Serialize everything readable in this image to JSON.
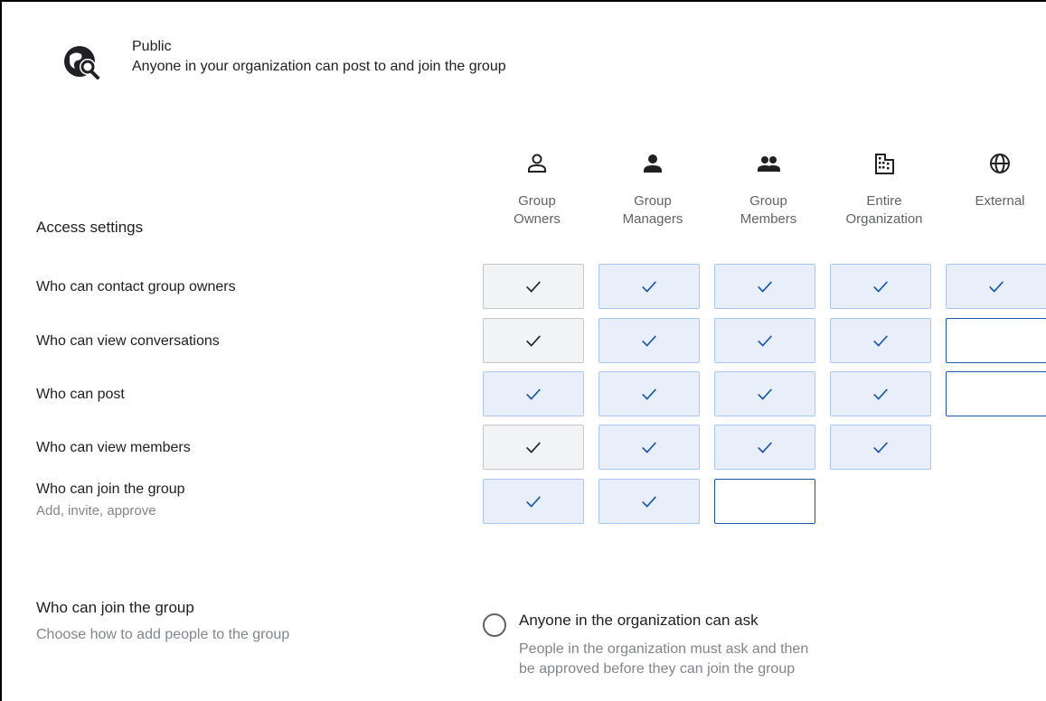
{
  "header": {
    "icon": "globe-search-icon",
    "title": "Public",
    "description": "Anyone in your organization can post to and join the group"
  },
  "columns": [
    {
      "icon": "person-outline-icon",
      "label": "Group\nOwners"
    },
    {
      "icon": "person-filled-icon",
      "label": "Group\nManagers"
    },
    {
      "icon": "people-icon",
      "label": "Group\nMembers"
    },
    {
      "icon": "building-icon",
      "label": "Entire\nOrganization"
    },
    {
      "icon": "globe-icon",
      "label": "External"
    }
  ],
  "access": {
    "title": "Access settings",
    "rows": [
      {
        "label": "Who can contact group owners",
        "sub": "",
        "cells": [
          "locked",
          "checked",
          "checked",
          "checked",
          "checked"
        ]
      },
      {
        "label": "Who can view conversations",
        "sub": "",
        "cells": [
          "locked",
          "checked",
          "checked",
          "checked",
          "empty"
        ]
      },
      {
        "label": "Who can post",
        "sub": "",
        "cells": [
          "checked",
          "checked",
          "checked",
          "checked",
          "empty"
        ]
      },
      {
        "label": "Who can view members",
        "sub": "",
        "cells": [
          "locked",
          "checked",
          "checked",
          "checked",
          "none"
        ]
      },
      {
        "label": "Who can join the group",
        "sub": "Add, invite, approve",
        "cells": [
          "checked",
          "checked",
          "empty",
          "none",
          "none"
        ]
      }
    ]
  },
  "join": {
    "title": "Who can join the group",
    "subtitle": "Choose how to add people to the group",
    "option_label": "Anyone in the organization can ask",
    "option_description": "People in the organization must ask and then be approved before they can join the group",
    "option_selected": false
  },
  "colors": {
    "accent": "#1a56a8",
    "checked_bg": "#e8effa",
    "locked_bg": "#f1f3f4"
  }
}
